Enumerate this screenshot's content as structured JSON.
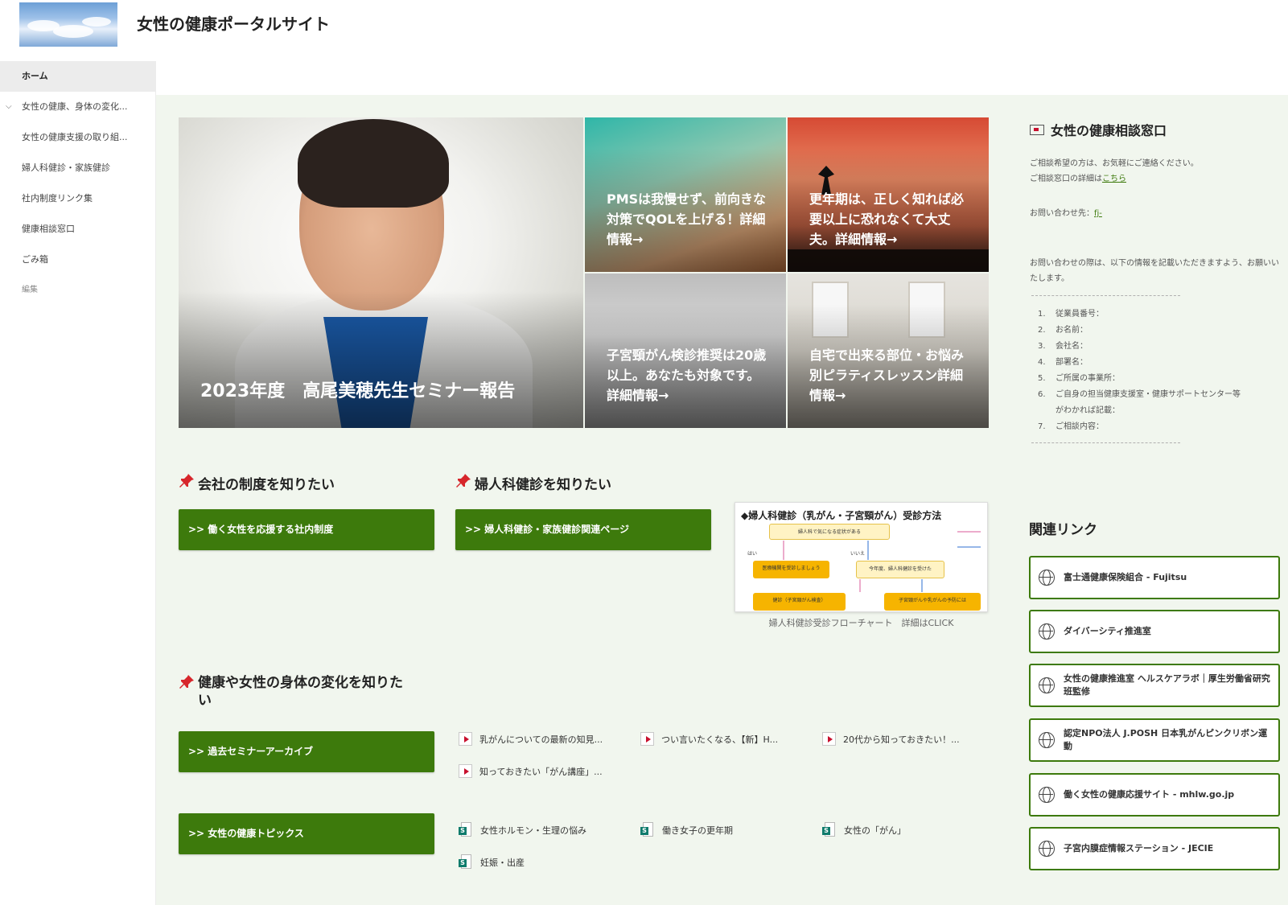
{
  "site": {
    "title": "女性の健康ポータルサイト"
  },
  "nav": {
    "items": [
      {
        "label": "ホーム",
        "active": true
      },
      {
        "label": "女性の健康、身体の変化..."
      },
      {
        "label": "女性の健康支援の取り組..."
      },
      {
        "label": "婦人科健診・家族健診"
      },
      {
        "label": "社内制度リンク集"
      },
      {
        "label": "健康相談窓口"
      },
      {
        "label": "ごみ箱"
      },
      {
        "label": "編集"
      }
    ]
  },
  "hero": {
    "main_caption": "2023年度　高尾美穂先生セミナー報告",
    "tiles": [
      "PMSは我慢せず、前向きな対策でQOLを上げる！詳細情報→",
      "更年期は、正しく知れば必要以上に恐れなくて大丈夫。詳細情報→",
      "子宮頸がん検診推奨は20歳以上。あなたも対象です。詳細情報→",
      "自宅で出来る部位・お悩み別ピラティスレッスン詳細情報→"
    ]
  },
  "sections": {
    "company": {
      "title": "会社の制度を知りたい",
      "button": ">> 働く女性を応援する社内制度"
    },
    "checkup": {
      "title": "婦人科健診を知りたい",
      "button": ">> 婦人科健診・家族健診関連ページ"
    },
    "health": {
      "title": "健康や女性の身体の変化を知りたい",
      "archive_button": ">> 過去セミナーアーカイブ",
      "topics_button": ">> 女性の健康トピックス"
    }
  },
  "flowchart": {
    "title": "◆婦人科健診（乳がん・子宮頸がん）受診方法",
    "boxes": {
      "top": "婦人科で気になる症状がある",
      "left": "医療機関を受診しましょう",
      "mid": "今年度、婦人科健診を受けた",
      "bottom_left": "健診（子宮頸がん検査）",
      "bottom_right": "子宮頸がんや乳がんの予防には"
    },
    "labels": {
      "yes": "はい",
      "no": "いいえ"
    },
    "caption": "婦人科健診受診フローチャート　詳細はCLICK"
  },
  "videos": [
    "乳がんについての最新の知見...",
    "つい言いたくなる、【新】H...",
    "20代から知っておきたい！...",
    "知っておきたい「がん講座」..."
  ],
  "topics": [
    "女性ホルモン・生理の悩み",
    "働き女子の更年期",
    "女性の「がん」",
    "妊娠・出産"
  ],
  "contact": {
    "title": "女性の健康相談窓口",
    "line1": "ご相談希望の方は、お気軽にご連絡ください。",
    "line2_prefix": "ご相談窓口の詳細は",
    "line2_link": "こちら",
    "inquiry_prefix": "お問い合わせ先：",
    "inquiry_link": "fj-",
    "note": "お問い合わせの際は、以下の情報を記載いただきますよう、お願いいたします。",
    "items": [
      "従業員番号：",
      "お名前：",
      "会社名：",
      "部署名：",
      "ご所属の事業所：",
      "ご自身の担当健康支援室・健康サポートセンター等",
      "ご相談内容："
    ],
    "item6_cont": "がわかれば記載："
  },
  "related": {
    "title": "関連リンク",
    "links": [
      "富士通健康保険組合 - Fujitsu",
      "ダイバーシティ推進室",
      "女性の健康推進室 ヘルスケアラボ｜厚生労働省研究班監修",
      "認定NPO法人 J.POSH 日本乳がんピンクリボン運動",
      "働く女性の健康応援サイト - mhlw.go.jp",
      "子宮内膜症情報ステーション - JECIE"
    ]
  },
  "colors": {
    "accent_green": "#3d7a0c",
    "content_bg": "#f1f6ee",
    "nav_active": "#ececec"
  },
  "icons": {
    "pin": "pushpin-icon",
    "globe": "globe-icon",
    "mail": "mail-icon",
    "video": "video-icon",
    "page": "page-icon"
  }
}
